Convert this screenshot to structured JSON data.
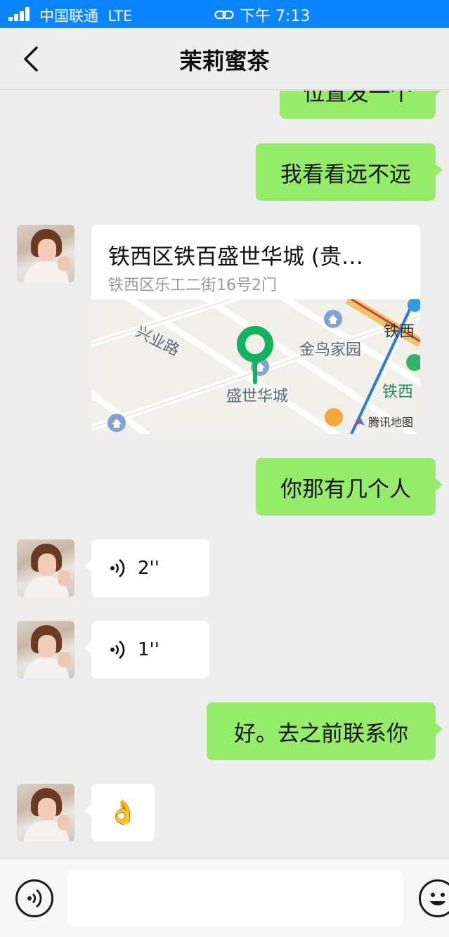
{
  "status_bar": {
    "carrier": "中国联通",
    "network": "LTE",
    "time": "下午 7:13"
  },
  "nav": {
    "title": "茉莉蜜茶"
  },
  "messages": {
    "m0": "位置发一个",
    "m1": "我看看远不远",
    "location": {
      "title": "铁西区铁百盛世华城 (贵…",
      "address": "铁西区乐工二街16号2门",
      "map_labels": {
        "road": "兴业路",
        "place1": "金鸟家园",
        "place2": "盛世华城",
        "place3": "铁西",
        "place4": "铁西",
        "provider": "腾讯地图"
      }
    },
    "m3": "你那有几个人",
    "voice1": "2''",
    "voice2": "1''",
    "m6": "好。去之前联系你",
    "emoji": "👌"
  },
  "colors": {
    "outgoing_bubble": "#95ec69",
    "status_bar": "#0a84ff",
    "map_pin": "#12b35c"
  }
}
